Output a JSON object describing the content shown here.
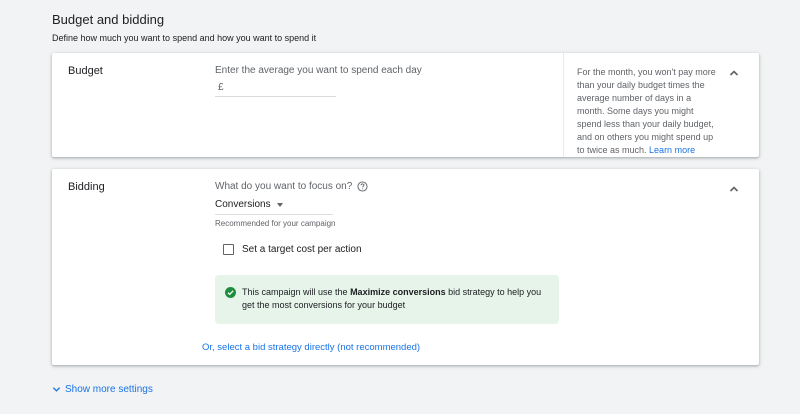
{
  "section": {
    "title": "Budget and bidding",
    "subtitle": "Define how much you want to spend and how you want to spend it"
  },
  "budget": {
    "label": "Budget",
    "prompt": "Enter the average you want to spend each day",
    "currency_symbol": "£",
    "amount_value": "",
    "help_text": "For the month, you won't pay more than your daily budget times the average number of days in a month. Some days you might spend less than your daily budget, and on others you might spend up to twice as much.",
    "learn_more": "Learn more",
    "collapse_icon": "chevron-up-icon"
  },
  "bidding": {
    "label": "Bidding",
    "focus_question": "What do you want to focus on?",
    "help_icon": "help-circle-icon",
    "focus_selected": "Conversions",
    "recommended": "Recommended for your campaign",
    "target_cpa_label": "Set a target cost per action",
    "target_cpa_checked": false,
    "info_prefix": "This campaign will use the ",
    "info_strategy": "Maximize conversions",
    "info_suffix": " bid strategy to help you get the most conversions for your budget",
    "info_icon": "check-circle-icon",
    "select_strategy_link": "Or, select a bid strategy directly (not recommended)",
    "collapse_icon": "chevron-up-icon"
  },
  "show_more": {
    "label": "Show more settings",
    "icon": "chevron-down-icon"
  },
  "colors": {
    "background": "#f1f3f4",
    "link": "#1a73e8",
    "success_bg": "#e6f4ea",
    "success_icon": "#1e8e3e"
  }
}
